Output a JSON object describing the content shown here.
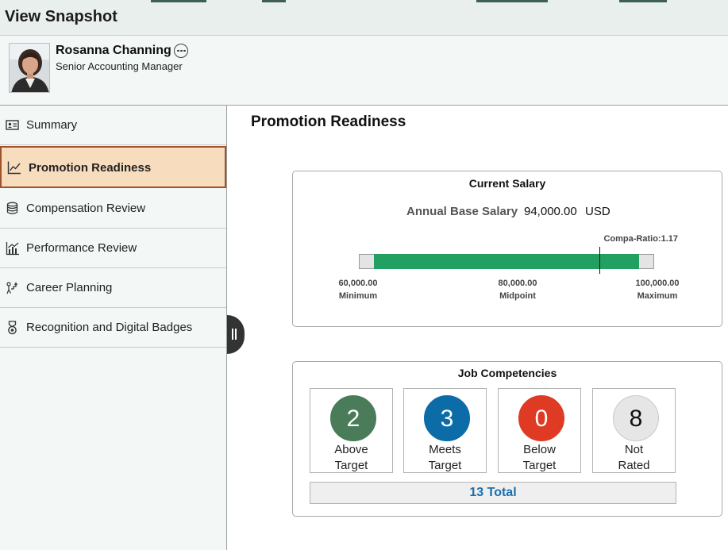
{
  "header": {
    "title": "View Snapshot"
  },
  "employee": {
    "name": "Rosanna Channing",
    "job_title": "Senior Accounting Manager"
  },
  "sidebar": {
    "items": [
      {
        "label": "Summary",
        "icon": "id-card-icon"
      },
      {
        "label": "Promotion Readiness",
        "icon": "line-chart-icon",
        "active": true
      },
      {
        "label": "Compensation Review",
        "icon": "coin-stack-icon"
      },
      {
        "label": "Performance Review",
        "icon": "bar-chart-icon"
      },
      {
        "label": "Career Planning",
        "icon": "career-steps-icon"
      },
      {
        "label": "Recognition and Digital Badges",
        "icon": "medal-icon"
      }
    ]
  },
  "main": {
    "title": "Promotion Readiness"
  },
  "salary": {
    "title": "Current Salary",
    "label": "Annual Base Salary",
    "amount": "94,000.00",
    "currency": "USD",
    "compa_ratio": "Compa-Ratio:1.17",
    "range_min": 60000,
    "range_max": 100000,
    "current": 94000,
    "minimum": {
      "value": "60,000.00",
      "label": "Minimum"
    },
    "midpoint": {
      "value": "80,000.00",
      "label": "Midpoint"
    },
    "maximum": {
      "value": "100,000.00",
      "label": "Maximum"
    },
    "bar_color": "#22a062"
  },
  "competencies": {
    "title": "Job Competencies",
    "items": [
      {
        "count": "2",
        "line1": "Above",
        "line2": "Target",
        "color": "#4a7c59"
      },
      {
        "count": "3",
        "line1": "Meets",
        "line2": "Target",
        "color": "#0b6ca8"
      },
      {
        "count": "0",
        "line1": "Below",
        "line2": "Target",
        "color": "#df3a24"
      },
      {
        "count": "8",
        "line1": "Not",
        "line2": "Rated",
        "color": "#e6e6e6"
      }
    ],
    "total": "13 Total"
  }
}
